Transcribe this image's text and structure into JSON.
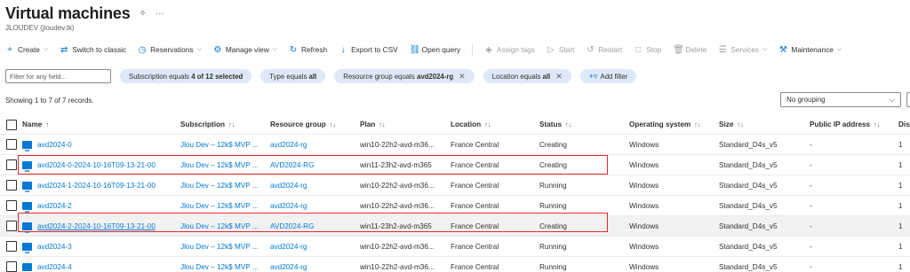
{
  "page": {
    "title": "Virtual machines",
    "pin_glyph": "✧",
    "more_glyph": "···",
    "subtitle": "JLOUDEV (jloudev.tk)"
  },
  "toolbar": [
    {
      "label": "Create",
      "icon": "plus-icon",
      "glyph": "+",
      "chevron": true,
      "disabled": false
    },
    {
      "label": "Switch to classic",
      "icon": "switch-icon",
      "glyph": "⇄",
      "chevron": false,
      "disabled": false
    },
    {
      "label": "Reservations",
      "icon": "clock-icon",
      "glyph": "◷",
      "chevron": true,
      "disabled": false
    },
    {
      "label": "Manage view",
      "icon": "gear-icon",
      "glyph": "⚙",
      "chevron": true,
      "disabled": false
    },
    {
      "label": "Refresh",
      "icon": "refresh-icon",
      "glyph": "↻",
      "chevron": false,
      "disabled": false
    },
    {
      "label": "Export to CSV",
      "icon": "download-icon",
      "glyph": "↓",
      "chevron": false,
      "disabled": false
    },
    {
      "label": "Open query",
      "icon": "query-icon",
      "glyph": "⛓",
      "chevron": false,
      "disabled": false
    },
    {
      "label": "Assign tags",
      "icon": "tag-icon",
      "glyph": "◈",
      "chevron": false,
      "disabled": true
    },
    {
      "label": "Start",
      "icon": "play-icon",
      "glyph": "▷",
      "chevron": false,
      "disabled": true
    },
    {
      "label": "Restart",
      "icon": "restart-icon",
      "glyph": "↺",
      "chevron": false,
      "disabled": true
    },
    {
      "label": "Stop",
      "icon": "stop-icon",
      "glyph": "□",
      "chevron": false,
      "disabled": true
    },
    {
      "label": "Delete",
      "icon": "trash-icon",
      "glyph": "🗑",
      "chevron": false,
      "disabled": true
    },
    {
      "label": "Services",
      "icon": "list-icon",
      "glyph": "☰",
      "chevron": true,
      "disabled": true
    },
    {
      "label": "Maintenance",
      "icon": "wrench-icon",
      "glyph": "⚒",
      "chevron": true,
      "disabled": false
    }
  ],
  "filters": {
    "search_placeholder": "Filter for any field...",
    "subscription": {
      "prefix": "Subscription equals ",
      "value": "4 of 12 selected"
    },
    "type": {
      "prefix": "Type equals ",
      "value": "all"
    },
    "resource_group": {
      "prefix": "Resource group equals ",
      "value": "avd2024-rg",
      "close": "✕"
    },
    "location": {
      "prefix": "Location equals ",
      "value": "all",
      "close": "✕"
    },
    "add_filter": "Add filter",
    "add_filter_glyph": "+▿"
  },
  "records_text": "Showing 1 to 7 of 7 records.",
  "grouping": {
    "value": "No grouping",
    "chevron": "⌵"
  },
  "columns": {
    "name": "Name",
    "subscription": "Subscription",
    "resource_group": "Resource group",
    "plan": "Plan",
    "location": "Location",
    "status": "Status",
    "os": "Operating system",
    "size": "Size",
    "public_ip": "Public IP address",
    "dis": "Dis",
    "sort_glyph": "↑↓",
    "name_sort_glyph": "↑"
  },
  "rows": [
    {
      "name": "avd2024-0",
      "subscription": "Jlou Dev – 12k$ MVP ...",
      "resource_group": "avd2024-rg",
      "plan": "win10-22h2-avd-m36...",
      "location": "France Central",
      "status": "Creating",
      "os": "Windows",
      "size": "Standard_D4s_v5",
      "public_ip": "-",
      "dis": "1"
    },
    {
      "name": "avd2024-0-2024-10-16T09-13-21-00",
      "subscription": "Jlou Dev – 12k$ MVP ...",
      "resource_group": "AVD2024-RG",
      "plan": "win11-23h2-avd-m365",
      "location": "France Central",
      "status": "Creating",
      "os": "Windows",
      "size": "Standard_D4s_v5",
      "public_ip": "-",
      "dis": "1"
    },
    {
      "name": "avd2024-1-2024-10-16T09-13-21-00",
      "subscription": "Jlou Dev – 12k$ MVP ...",
      "resource_group": "avd2024-rg",
      "plan": "win10-22h2-avd-m36...",
      "location": "France Central",
      "status": "Running",
      "os": "Windows",
      "size": "Standard_D4s_v5",
      "public_ip": "-",
      "dis": "1"
    },
    {
      "name": "avd2024-2",
      "subscription": "Jlou Dev – 12k$ MVP ...",
      "resource_group": "avd2024-rg",
      "plan": "win10-22h2-avd-m36...",
      "location": "France Central",
      "status": "Running",
      "os": "Windows",
      "size": "Standard_D4s_v5",
      "public_ip": "-",
      "dis": "1"
    },
    {
      "name": "avd2024-2-2024-10-16T09-13-21-00",
      "subscription": "Jlou Dev – 12k$ MVP ...",
      "resource_group": "AVD2024-RG",
      "plan": "win11-23h2-avd-m365",
      "location": "France Central",
      "status": "Creating",
      "os": "Windows",
      "size": "Standard_D4s_v5",
      "public_ip": "-",
      "dis": "1"
    },
    {
      "name": "avd2024-3",
      "subscription": "Jlou Dev – 12k$ MVP ...",
      "resource_group": "avd2024-rg",
      "plan": "win10-22h2-avd-m36...",
      "location": "France Central",
      "status": "Running",
      "os": "Windows",
      "size": "Standard_D4s_v5",
      "public_ip": "-",
      "dis": "1"
    },
    {
      "name": "avd2024-4",
      "subscription": "Jlou Dev – 12k$ MVP ...",
      "resource_group": "avd2024-rg",
      "plan": "win10-22h2-avd-m36...",
      "location": "France Central",
      "status": "Running",
      "os": "Windows",
      "size": "Standard_D4s_v5",
      "public_ip": "-",
      "dis": "1"
    }
  ],
  "colors": {
    "accent": "#0078d4",
    "highlight_box": "#e0282e",
    "pill_bg": "#dde9f7"
  }
}
